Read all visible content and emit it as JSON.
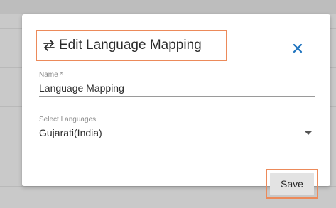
{
  "dialog": {
    "title": "Edit Language Mapping",
    "title_icon": "swap-arrows-icon",
    "close_icon": "close-icon",
    "accent_color": "#1e73be",
    "highlight_color": "#ec8a5a"
  },
  "form": {
    "name": {
      "label": "Name *",
      "value": "Language Mapping"
    },
    "languages": {
      "label": "Select Languages",
      "value": "Gujarati(India)",
      "icon": "dropdown-caret-icon"
    }
  },
  "actions": {
    "save_label": "Save"
  }
}
